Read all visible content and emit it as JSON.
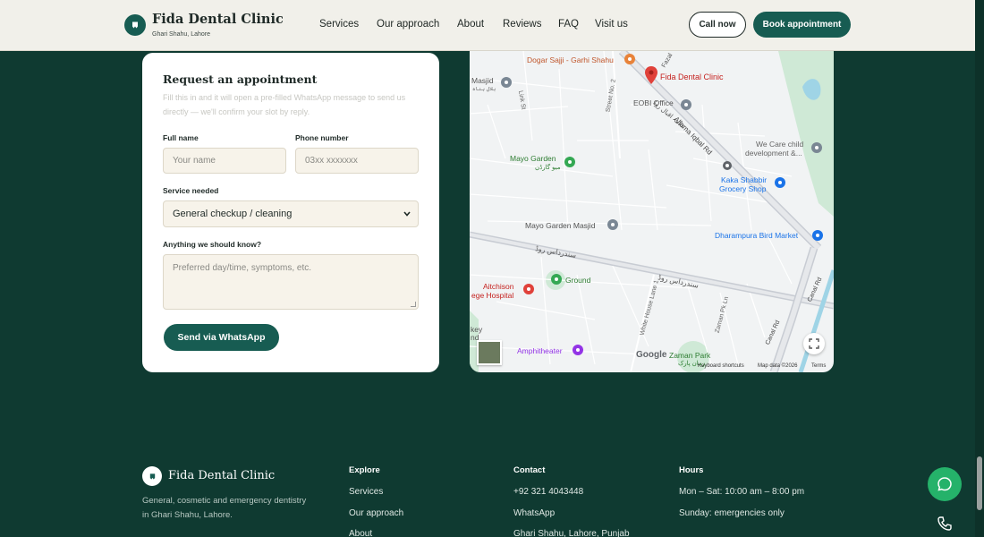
{
  "header": {
    "brand": "Fida Dental Clinic",
    "tagline": "Ghari Shahu, Lahore",
    "nav": [
      "Services",
      "Our approach",
      "About",
      "Reviews",
      "FAQ",
      "Visit us"
    ],
    "call_label": "Call now",
    "book_label": "Book appointment"
  },
  "form": {
    "title": "Request an appointment",
    "intro": "Fill this in and it will open a pre-filled WhatsApp message to send us directly — we'll confirm your slot by reply.",
    "name_label": "Full name",
    "name_placeholder": "Your name",
    "phone_label": "Phone number",
    "phone_placeholder": "03xx xxxxxxx",
    "service_label": "Service needed",
    "service_value": "General checkup / cleaning",
    "notes_label": "Anything we should know?",
    "notes_placeholder": "Preferred day/time, symptoms, etc.",
    "submit_label": "Send via WhatsApp"
  },
  "map": {
    "places": {
      "dogar": "Dogar Sajji - Garhi Shahu",
      "clinic": "Fida Dental Clinic",
      "masjid": "Masjid",
      "masjid_sub": "بلال ہناہ",
      "eobi": "EOBI Office",
      "allama": "Allama Iqbal Rd",
      "allama_ur": "علامہ اقبال روڈ",
      "wecare": "We Care child",
      "wecare2": "development &...",
      "mayo": "Mayo Garden",
      "mayo_ur": "میو گارڈن",
      "kaka": "Kaka Shabbir",
      "kaka2": "Grocery Shop",
      "mayo_masjid": "Mayo Garden Masjid",
      "dharampura": "Dharampura Bird Market",
      "sundar": "سندرداس روڈ",
      "sundar2": "سندرداس روڈ",
      "aitchison": "Aitchison",
      "aitchison2": "ege Hospital",
      "ground": "Ground",
      "canal": "Canal Rd",
      "canal2": "Canal Rd",
      "amphitheater": "Amphitheater",
      "zaman": "Zaman Park",
      "zaman_ur": "زمان پارک",
      "white_house": "White House Lane 1",
      "zaman_ln": "Zaman Pk Ln",
      "street2": "Street No. 2",
      "link": "Link St",
      "fazal": "Fazal",
      "key": "key",
      "nd": "nd"
    },
    "google": "Google",
    "shortcuts": "Keyboard shortcuts",
    "mapdata": "Map data ©2026",
    "terms": "Terms"
  },
  "footer": {
    "brand": "Fida Dental Clinic",
    "desc": "General, cosmetic and emergency dentistry in Ghari Shahu, Lahore.",
    "explore_title": "Explore",
    "explore": [
      "Services",
      "Our approach",
      "About"
    ],
    "contact_title": "Contact",
    "contact": [
      "+92 321 4043448",
      "WhatsApp",
      "Ghari Shahu, Lahore, Punjab"
    ],
    "hours_title": "Hours",
    "hours": [
      "Mon – Sat: 10:00 am – 8:00 pm",
      "Sunday: emergencies only"
    ]
  },
  "colors": {
    "brand": "#175c52",
    "page_bg": "#0f3a31",
    "whatsapp": "#25b26a",
    "map_pin": "#e0413a"
  },
  "icons": [
    "tooth-logo-icon",
    "chevron-down-icon",
    "map-pin-icon",
    "fullscreen-icon",
    "whatsapp-chat-icon",
    "phone-icon"
  ]
}
